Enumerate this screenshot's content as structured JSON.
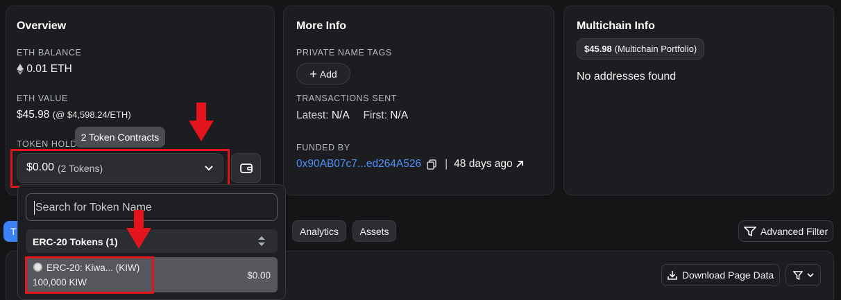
{
  "overview": {
    "title": "Overview",
    "eth_balance_label": "ETH BALANCE",
    "eth_balance_value": "0.01 ETH",
    "eth_value_label": "ETH VALUE",
    "eth_value_main": "$45.98",
    "eth_value_sub": "(@ $4,598.24/ETH)",
    "token_holdings_label": "TOKEN HOLDI",
    "token_value": "$0.00",
    "token_count": "(2 Tokens)",
    "tooltip": "2 Token Contracts"
  },
  "more_info": {
    "title": "More Info",
    "private_tags_label": "PRIVATE NAME TAGS",
    "add_label": "Add",
    "tx_sent_label": "TRANSACTIONS SENT",
    "latest_label": "Latest:",
    "latest_value": "N/A",
    "first_label": "First:",
    "first_value": "N/A",
    "funded_by_label": "FUNDED BY",
    "funded_by_address": "0x90AB07c7...ed264A526",
    "separator": "|",
    "funded_age": "48 days ago"
  },
  "multichain": {
    "title": "Multichain Info",
    "portfolio_value": "$45.98",
    "portfolio_label": "(Multichain Portfolio)",
    "no_addresses": "No addresses found"
  },
  "dropdown": {
    "search_placeholder": "Search for Token Name",
    "section_label": "ERC-20 Tokens (1)",
    "token_name": "ERC-20: Kiwa... (KIW)",
    "token_amount": "100,000 KIW",
    "token_value": "$0.00"
  },
  "tabs": {
    "first_tab_partial": "T",
    "analytics": "Analytics",
    "assets": "Assets",
    "advanced_filter": "Advanced Filter",
    "download": "Download Page Data"
  },
  "colors": {
    "accent_link": "#4f8ff7",
    "annotation_red": "#e3141b",
    "active_tab": "#3b82f6"
  }
}
